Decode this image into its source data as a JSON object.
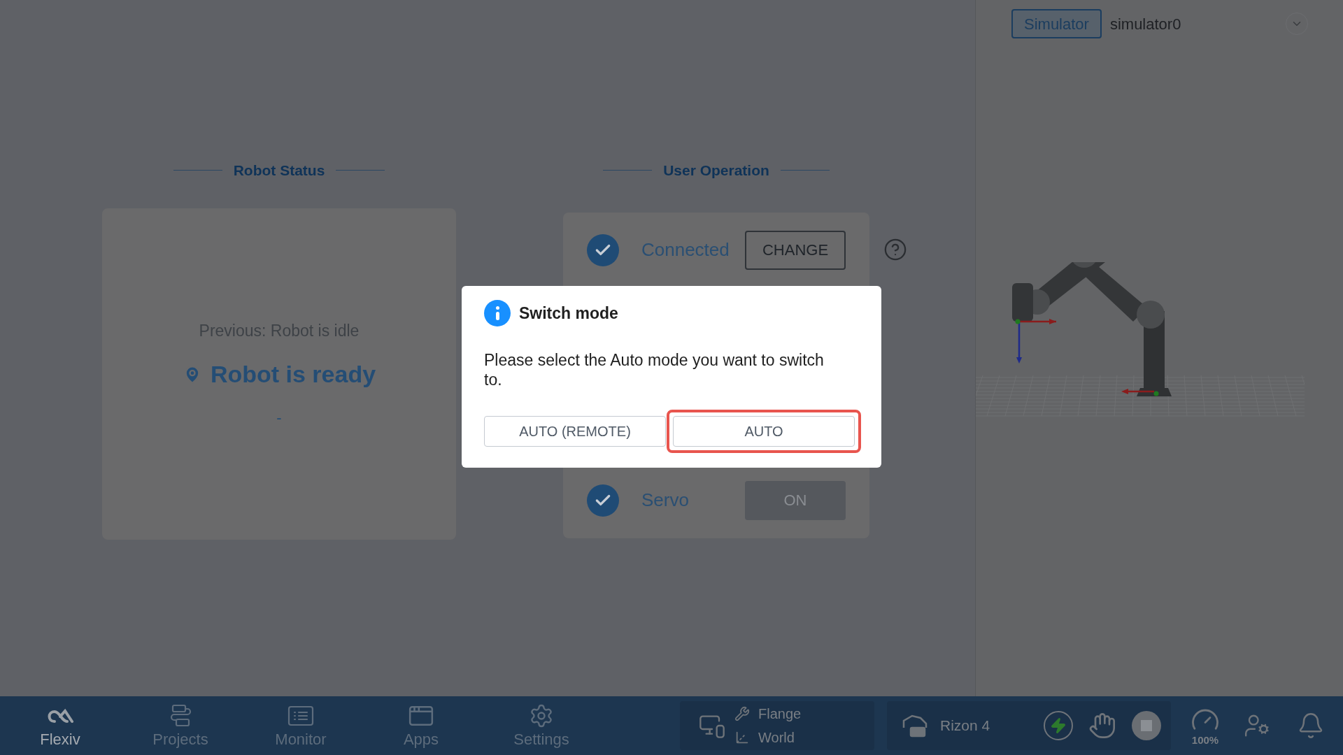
{
  "top_bar": {
    "mode_tag": "Simulator",
    "device": "simulator0"
  },
  "robot_status": {
    "heading": "Robot Status",
    "previous": "Previous: Robot is idle",
    "current": "Robot is ready",
    "detail": "-"
  },
  "user_operation": {
    "heading": "User Operation",
    "rows": [
      {
        "label": "Connected",
        "checked": true,
        "button": "CHANGE",
        "disabled": false
      },
      {
        "label": "Servo",
        "checked": true,
        "button": "ON",
        "disabled": true
      }
    ]
  },
  "dialog": {
    "title": "Switch mode",
    "message": "Please select the Auto mode you want to switch to.",
    "options": [
      {
        "label": "AUTO (REMOTE)",
        "selected": false
      },
      {
        "label": "AUTO",
        "selected": true
      }
    ]
  },
  "nav": [
    {
      "kind": "logo",
      "label": "Flexiv",
      "selected": true
    },
    {
      "kind": "projects",
      "label": "Projects",
      "selected": false
    },
    {
      "kind": "monitor",
      "label": "Monitor",
      "selected": false
    },
    {
      "kind": "apps",
      "label": "Apps",
      "selected": false
    },
    {
      "kind": "settings",
      "label": "Settings",
      "selected": false
    }
  ],
  "frames": [
    "Flange",
    "World"
  ],
  "robot": {
    "name": "Rizon 4"
  },
  "speed": "100%"
}
